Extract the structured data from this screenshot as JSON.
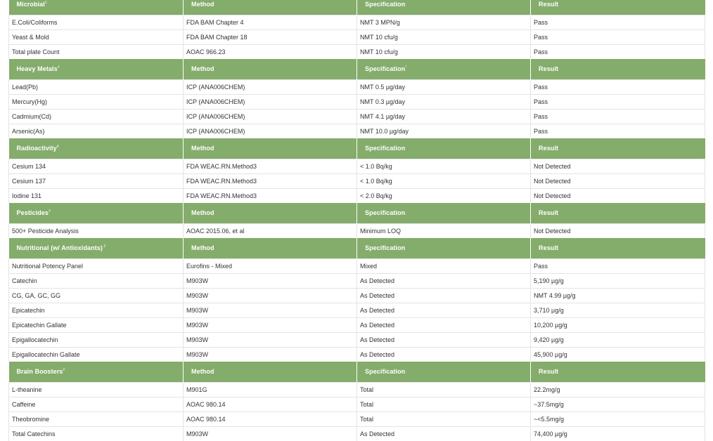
{
  "sections": [
    {
      "header": [
        "Microbial",
        "Method",
        "Specification",
        "Result"
      ],
      "marks": [
        "1",
        "",
        "",
        ""
      ],
      "rows": [
        [
          "E.Coli/Coliforms",
          "FDA BAM Chapter 4",
          "NMT 3 MPN/g",
          "Pass"
        ],
        [
          "Yeast & Mold",
          "FDA BAM Chapter 18",
          "NMT 10 cfu/g",
          "Pass"
        ],
        [
          "Total plate Count",
          "AOAC 966.23",
          "NMT 10 cfu/g",
          "Pass"
        ]
      ]
    },
    {
      "header": [
        "Heavy Metals",
        "Method",
        "Specification",
        "Result"
      ],
      "marks": [
        "2",
        "",
        "*",
        ""
      ],
      "rows": [
        [
          "Lead(Pb)",
          "ICP (ANA006CHEM)",
          "NMT 0.5 µg/day",
          "Pass"
        ],
        [
          "Mercury(Hg)",
          "ICP (ANA006CHEM)",
          "NMT 0.3 µg/day",
          "Pass"
        ],
        [
          "Cadmium(Cd)",
          "ICP (ANA006CHEM)",
          "NMT 4.1 µg/day",
          "Pass"
        ],
        [
          "Arsenic(As)",
          "ICP (ANA006CHEM)",
          "NMT 10.0 µg/day",
          "Pass"
        ]
      ]
    },
    {
      "header": [
        "Radioactivity",
        "Method",
        "Specification",
        "Result"
      ],
      "marks": [
        "4",
        "",
        "",
        ""
      ],
      "rows": [
        [
          "Cesium 134",
          "FDA WEAC.RN.Method3",
          "< 1.0 Bq/kg",
          "Not Detected"
        ],
        [
          "Cesium 137",
          "FDA WEAC.RN.Method3",
          "< 1.0 Bq/kg",
          "Not Detected"
        ],
        [
          "Iodine 131",
          "FDA WEAC.RN.Method3",
          "< 2.0 Bq/kg",
          "Not Detected"
        ]
      ]
    },
    {
      "header": [
        "Pesticides",
        "Method",
        "Specification",
        "Result"
      ],
      "marks": [
        "2",
        "",
        "",
        ""
      ],
      "rows": [
        [
          "500+ Pesticide Analysis",
          "AOAC 2015.06, et al",
          "Minimum LOQ",
          "Not Detected"
        ]
      ]
    },
    {
      "header": [
        "Nutritional (w/ Antioxidants)",
        "Method",
        "Specification",
        "Result"
      ],
      "marks": [
        " 2",
        "",
        "",
        ""
      ],
      "rows": [
        [
          "Nutritional Potency Panel",
          "Eurofins - Mixed",
          "Mixed",
          "Pass"
        ],
        [
          "Catechin",
          "M903W",
          "As Detected",
          "5,190 µg/g"
        ],
        [
          "CG, GA, GC, GG",
          "M903W",
          "As Detected",
          "NMT 4.99 µg/g"
        ],
        [
          "Epicatechin",
          "M903W",
          "As Detected",
          "3,710 µg/g"
        ],
        [
          "Epicatechin Gallate",
          "M903W",
          "As Detected",
          "10,200 µg/g"
        ],
        [
          "Epigallocatechin",
          "M903W",
          "As Detected",
          "9,420 µg/g"
        ],
        [
          "Epigallocatechin Gallate",
          "M903W",
          "As Detected",
          "45,900 µg/g"
        ]
      ]
    },
    {
      "header": [
        "Brain Boosters",
        "Method",
        "Specification",
        "Result"
      ],
      "marks": [
        "2",
        "",
        "",
        ""
      ],
      "rows": [
        [
          "L-theanine",
          "M901G",
          "Total",
          "22.2mg/g"
        ],
        [
          "Caffeine",
          "AOAC 980.14",
          "Total",
          "~37.5mg/g"
        ],
        [
          "Theobromine",
          "AOAC 980.14",
          "Total",
          "~<5.5mg/g"
        ],
        [
          "Total Catechins",
          "M903W",
          "As Detected",
          "74,400 µg/g"
        ]
      ]
    }
  ]
}
